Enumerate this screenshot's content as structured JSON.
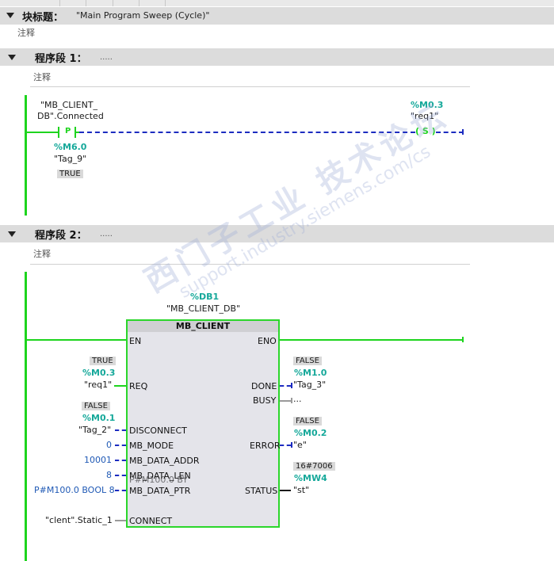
{
  "block": {
    "title_label": "块标题：",
    "title_value": "\"Main Program Sweep (Cycle)\"",
    "comment": "注释"
  },
  "network1": {
    "title": "程序段 1：",
    "dots": ".....",
    "comment": "注释",
    "contact": {
      "symbol": "P",
      "tag_line1": "\"MB_CLIENT_",
      "tag_line2": "DB\".Connected",
      "edge_addr": "%M6.0",
      "edge_tag": "\"Tag_9\"",
      "edge_value": "TRUE"
    },
    "coil": {
      "symbol": "( S )",
      "addr": "%M0.3",
      "tag": "\"req1\""
    }
  },
  "network2": {
    "title": "程序段 2：",
    "dots": ".....",
    "comment": "注释",
    "instance": {
      "addr": "%DB1",
      "name": "\"MB_CLIENT_DB\""
    },
    "block_name": "MB_CLIENT",
    "inputs": {
      "en": "EN",
      "req": {
        "pin": "REQ",
        "value": "TRUE",
        "addr": "%M0.3",
        "tag": "\"req1\""
      },
      "disconnect": {
        "pin": "DISCONNECT",
        "value": "FALSE",
        "addr": "%M0.1",
        "tag": "\"Tag_2\""
      },
      "mb_mode": {
        "pin": "MB_MODE",
        "const": "0"
      },
      "mb_data_addr": {
        "pin": "MB_DATA_ADDR",
        "const": "10001"
      },
      "mb_data_len": {
        "pin": "MB_DATA_LEN",
        "const": "8",
        "overlap": "P#M100.0 BY"
      },
      "mb_data_ptr": {
        "pin": "MB_DATA_PTR",
        "const": "P#M100.0 BOOL 8"
      },
      "connect": {
        "pin": "CONNECT",
        "tag": "\"clent\".Static_1"
      }
    },
    "outputs": {
      "eno": "ENO",
      "done": {
        "pin": "DONE",
        "value": "FALSE",
        "addr": "%M1.0",
        "tag": "\"Tag_3\""
      },
      "busy": {
        "pin": "BUSY",
        "tag": "..."
      },
      "error": {
        "pin": "ERROR",
        "value": "FALSE",
        "addr": "%M0.2",
        "tag": "\"e\""
      },
      "status": {
        "pin": "STATUS",
        "value": "16#7006",
        "addr": "%MW4",
        "tag": "\"st\""
      }
    }
  },
  "watermark": {
    "line1": "西门子工业 技术论坛",
    "line2": "support.industry.siemens.com/cs"
  },
  "colors": {
    "powerflow": "#1ed41e",
    "no_powerflow": "#1c2cc0",
    "address": "#15a89a",
    "constant": "#1f59b5"
  }
}
